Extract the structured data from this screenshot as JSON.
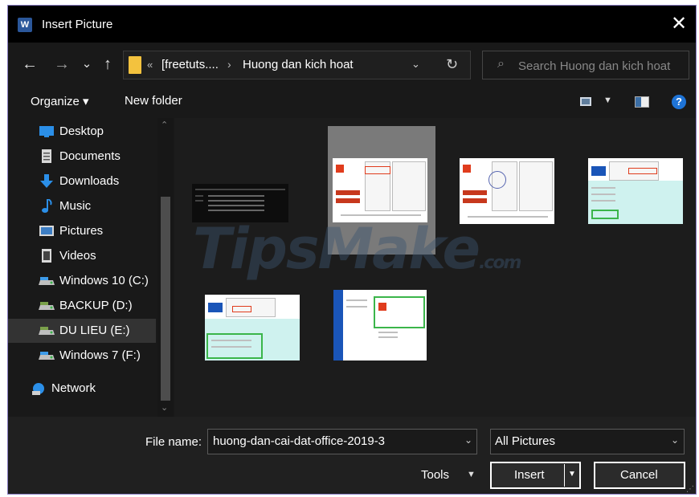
{
  "window": {
    "title": "Insert Picture",
    "app_icon": "word-icon",
    "close": "✕"
  },
  "nav": {
    "back": "←",
    "forward": "→",
    "recent": "⌄",
    "up": "↑"
  },
  "address": {
    "prefix": "«",
    "crumb1": "[freetuts....",
    "separator": "›",
    "crumb2": "Huong dan kich hoat",
    "dropdown": "⌄",
    "refresh": "↻"
  },
  "search": {
    "icon": "⌕",
    "placeholder": "Search Huong dan kich hoat"
  },
  "toolbar": {
    "organize": "Organize ▾",
    "new_folder": "New folder",
    "view_dropdown": "▼",
    "help": "?"
  },
  "sidebar": {
    "items": [
      {
        "label": "Desktop",
        "icon": "desktop-icon"
      },
      {
        "label": "Documents",
        "icon": "documents-icon"
      },
      {
        "label": "Downloads",
        "icon": "downloads-icon"
      },
      {
        "label": "Music",
        "icon": "music-icon"
      },
      {
        "label": "Pictures",
        "icon": "pictures-icon"
      },
      {
        "label": "Videos",
        "icon": "videos-icon"
      },
      {
        "label": "Windows 10 (C:)",
        "icon": "drive-icon"
      },
      {
        "label": "BACKUP (D:)",
        "icon": "drive-icon"
      },
      {
        "label": "DU LIEU (E:)",
        "icon": "drive-icon",
        "selected": true
      },
      {
        "label": "Windows 7 (F:)",
        "icon": "drive-icon"
      },
      {
        "label": "Network",
        "icon": "network-icon"
      }
    ],
    "scroll_up": "⌃",
    "scroll_down": "⌄"
  },
  "files": {
    "selected_index": 1,
    "count": 6
  },
  "watermark": {
    "text": "TipsMake",
    "suffix": ".com"
  },
  "footer": {
    "file_name_label": "File name:",
    "file_name_value": "huong-dan-cai-dat-office-2019-3",
    "file_name_dropdown": "⌄",
    "filter_value": "All Pictures",
    "filter_dropdown": "⌄",
    "tools_label": "Tools",
    "tools_dropdown": "▼",
    "insert_label": "Insert",
    "insert_dropdown": "▼",
    "cancel_label": "Cancel",
    "grip": "⋰"
  },
  "colors": {
    "dialog_bg": "#191919",
    "border_accent": "#8b7fc4",
    "folder_yellow": "#f3c23e",
    "office_red": "#e03c1d",
    "highlight_green": "#3bb54a"
  }
}
